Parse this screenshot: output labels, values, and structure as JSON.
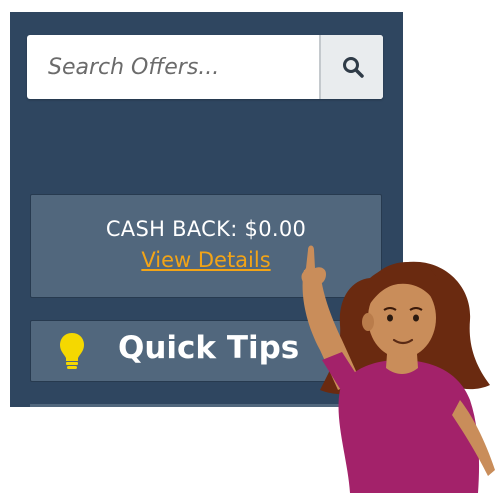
{
  "search": {
    "placeholder": "Search Offers...",
    "button_icon": "search-icon"
  },
  "cashback": {
    "label": "CASH BACK: $0.00",
    "link_text": "View Details",
    "link_color": "#f2a417"
  },
  "tips": {
    "label": "Quick Tips",
    "icon": "lightbulb-icon",
    "icon_color": "#f5d800"
  },
  "colors": {
    "panel_bg": "#2f4660",
    "card_bg": "#51677d"
  }
}
